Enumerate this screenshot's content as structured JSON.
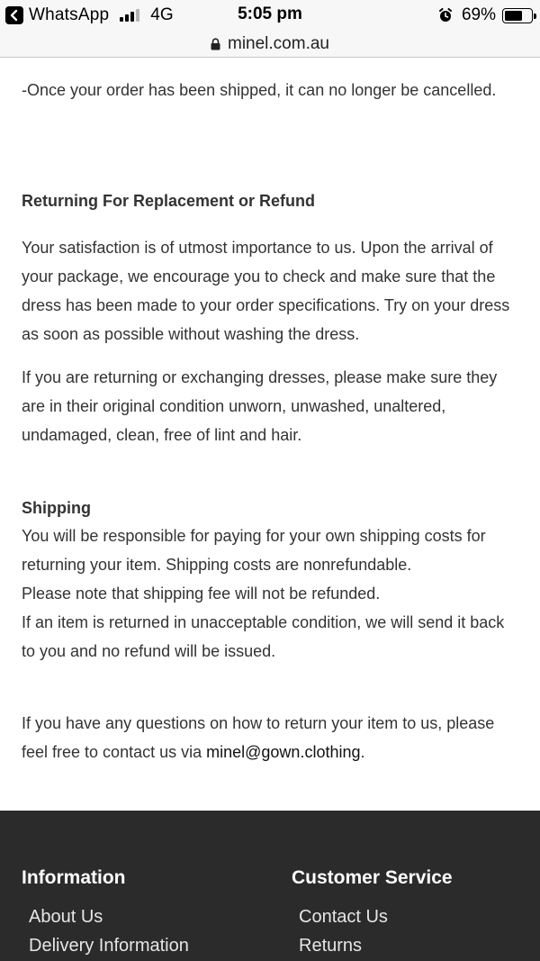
{
  "status_bar": {
    "back_app": "WhatsApp",
    "network": "4G",
    "time": "5:05 pm",
    "battery_percent": "69%",
    "battery_level": 0.69
  },
  "url_bar": {
    "url": "minel.com.au"
  },
  "content": {
    "cancel_note": "-Once your order has been shipped, it can no longer be cancelled.",
    "returning_heading": "Returning For Replacement or Refund",
    "satisfaction_paragraph": "Your satisfaction is of utmost importance to us. Upon the arrival of your package, we encourage you to check and make sure that the dress has been made to your order specifications. Try on your dress as soon as possible without washing the dress.",
    "condition_paragraph": "If you are returning or exchanging dresses, please make sure they are in their original condition unworn, unwashed, unaltered, undamaged, clean, free of lint and hair.",
    "shipping_heading": "Shipping",
    "shipping_line_1": "You will be responsible for paying for your own shipping costs for returning your item. Shipping costs are nonrefundable.",
    "shipping_line_2": "Please note that shipping fee will not be refunded.",
    "shipping_line_3": "If an item is returned in unacceptable condition, we will send it back to you and no refund will be issued.",
    "contact_paragraph_prefix": "If you have any questions on how to return your item to us, please feel free to contact us via ",
    "contact_email": "minel@gown.clothing",
    "contact_paragraph_suffix": "."
  },
  "footer": {
    "information": {
      "title": "Information",
      "links": [
        "About Us",
        "Delivery Information"
      ]
    },
    "customer_service": {
      "title": "Customer Service",
      "links": [
        "Contact Us",
        "Returns"
      ]
    }
  }
}
